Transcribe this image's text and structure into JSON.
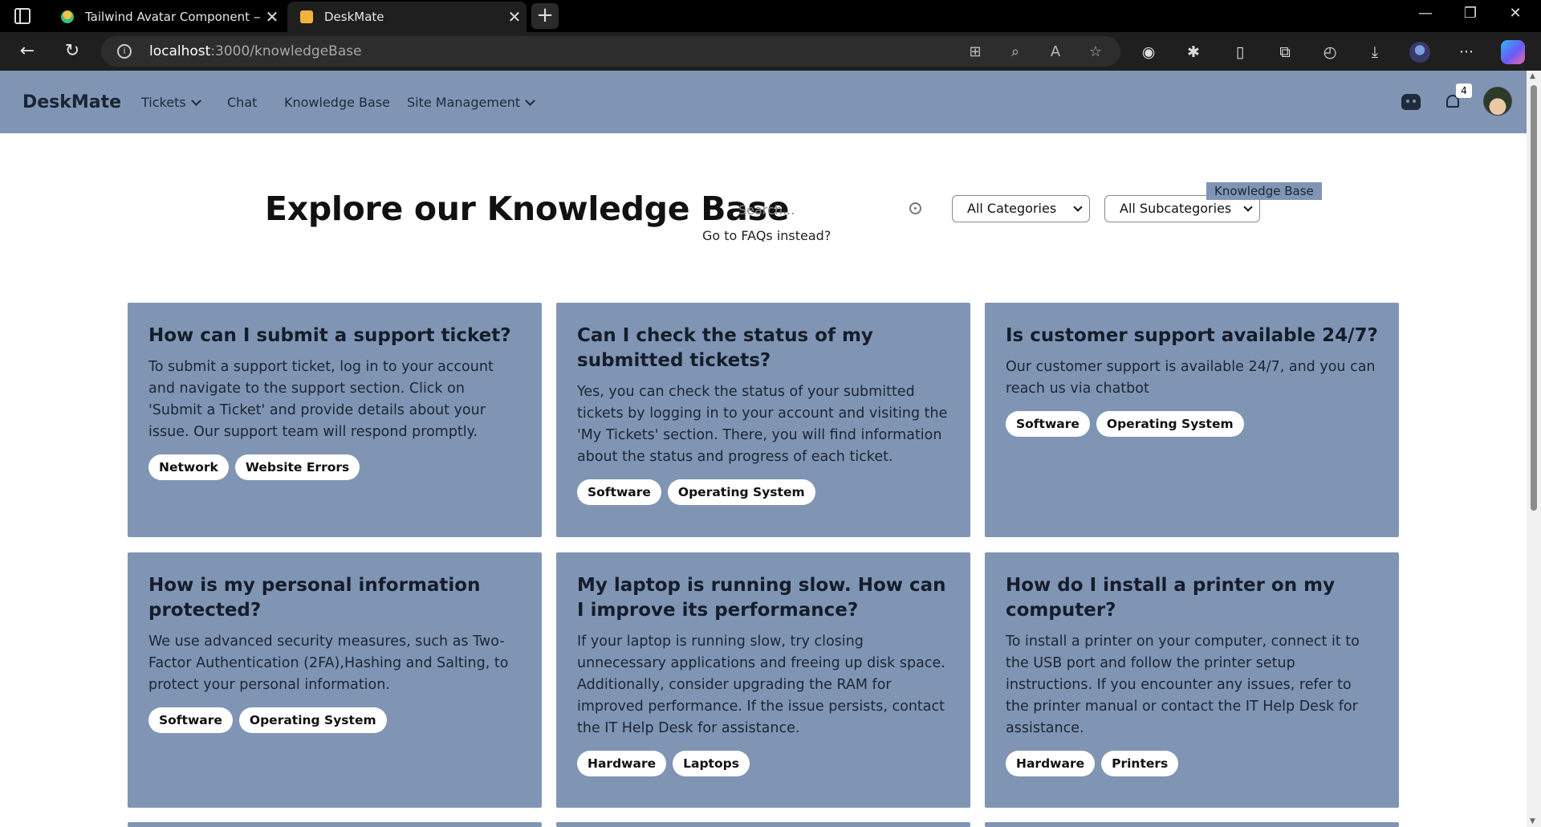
{
  "browser": {
    "tabs": [
      {
        "title": "Tailwind Avatar Component — Ta",
        "active": false
      },
      {
        "title": "DeskMate",
        "active": true
      }
    ],
    "url_host": "localhost",
    "url_path": ":3000/knowledgeBase"
  },
  "nav": {
    "brand": "DeskMate",
    "items": [
      {
        "label": "Tickets",
        "dropdown": true
      },
      {
        "label": "Chat",
        "dropdown": false
      },
      {
        "label": "Knowledge Base",
        "dropdown": false
      },
      {
        "label": "Site Management",
        "dropdown": true
      }
    ],
    "notification_count": "4"
  },
  "hero": {
    "title": "Explore our Knowledge Base",
    "search_placeholder": "Search...",
    "faq_link": "Go to FAQs instead?",
    "category_select": "All Categories",
    "subcategory_select": "All Subcategories",
    "tooltip": "Knowledge Base"
  },
  "cards": [
    {
      "title": "How can I submit a support ticket?",
      "body": "To submit a support ticket, log in to your account and navigate to the support section. Click on 'Submit a Ticket' and provide details about your issue. Our support team will respond promptly.",
      "tags": [
        "Network",
        "Website Errors"
      ]
    },
    {
      "title": "Can I check the status of my submitted tickets?",
      "body": "Yes, you can check the status of your submitted tickets by logging in to your account and visiting the 'My Tickets' section. There, you will find information about the status and progress of each ticket.",
      "tags": [
        "Software",
        "Operating System"
      ]
    },
    {
      "title": "Is customer support available 24/7?",
      "body": "Our customer support is available 24/7, and you can reach us via chatbot",
      "tags": [
        "Software",
        "Operating System"
      ]
    },
    {
      "title": "How is my personal information protected?",
      "body": "We use advanced security measures, such as Two-Factor Authentication (2FA),Hashing and Salting, to protect your personal information.",
      "tags": [
        "Software",
        "Operating System"
      ]
    },
    {
      "title": "My laptop is running slow. How can I improve its performance?",
      "body": "If your laptop is running slow, try closing unnecessary applications and freeing up disk space. Additionally, consider upgrading the RAM for improved performance. If the issue persists, contact the IT Help Desk for assistance.",
      "tags": [
        "Hardware",
        "Laptops"
      ]
    },
    {
      "title": "How do I install a printer on my computer?",
      "body": "To install a printer on your computer, connect it to the USB port and follow the printer setup instructions. If you encounter any issues, refer to the printer manual or contact the IT Help Desk for assistance.",
      "tags": [
        "Hardware",
        "Printers"
      ]
    }
  ]
}
